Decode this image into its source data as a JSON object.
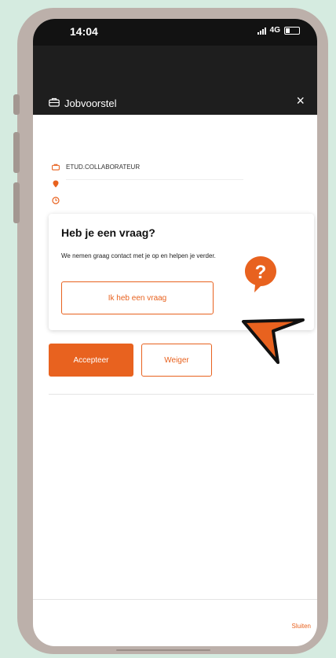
{
  "status_bar": {
    "time": "14:04",
    "network": "4G"
  },
  "header": {
    "title": "Jobvoorstel",
    "close_symbol": "×",
    "icon": "briefcase-icon"
  },
  "job_info": {
    "title": "ETUD.COLLABORATEUR",
    "icons": [
      "briefcase-icon",
      "location-pin-icon",
      "clock-icon"
    ]
  },
  "question_card": {
    "heading": "Heb je een vraag?",
    "text": "We nemen graag contact met je op en helpen je verder.",
    "button_label": "Ik heb een vraag",
    "icon": "question-bubble-icon"
  },
  "actions": {
    "accept_label": "Accepteer",
    "decline_label": "Weiger"
  },
  "footer": {
    "close_label": "Sluiten"
  },
  "colors": {
    "accent": "#e8621f",
    "header_bg": "#1e1e1e",
    "background": "#d5ebe0",
    "frame": "#bcb0aa"
  }
}
